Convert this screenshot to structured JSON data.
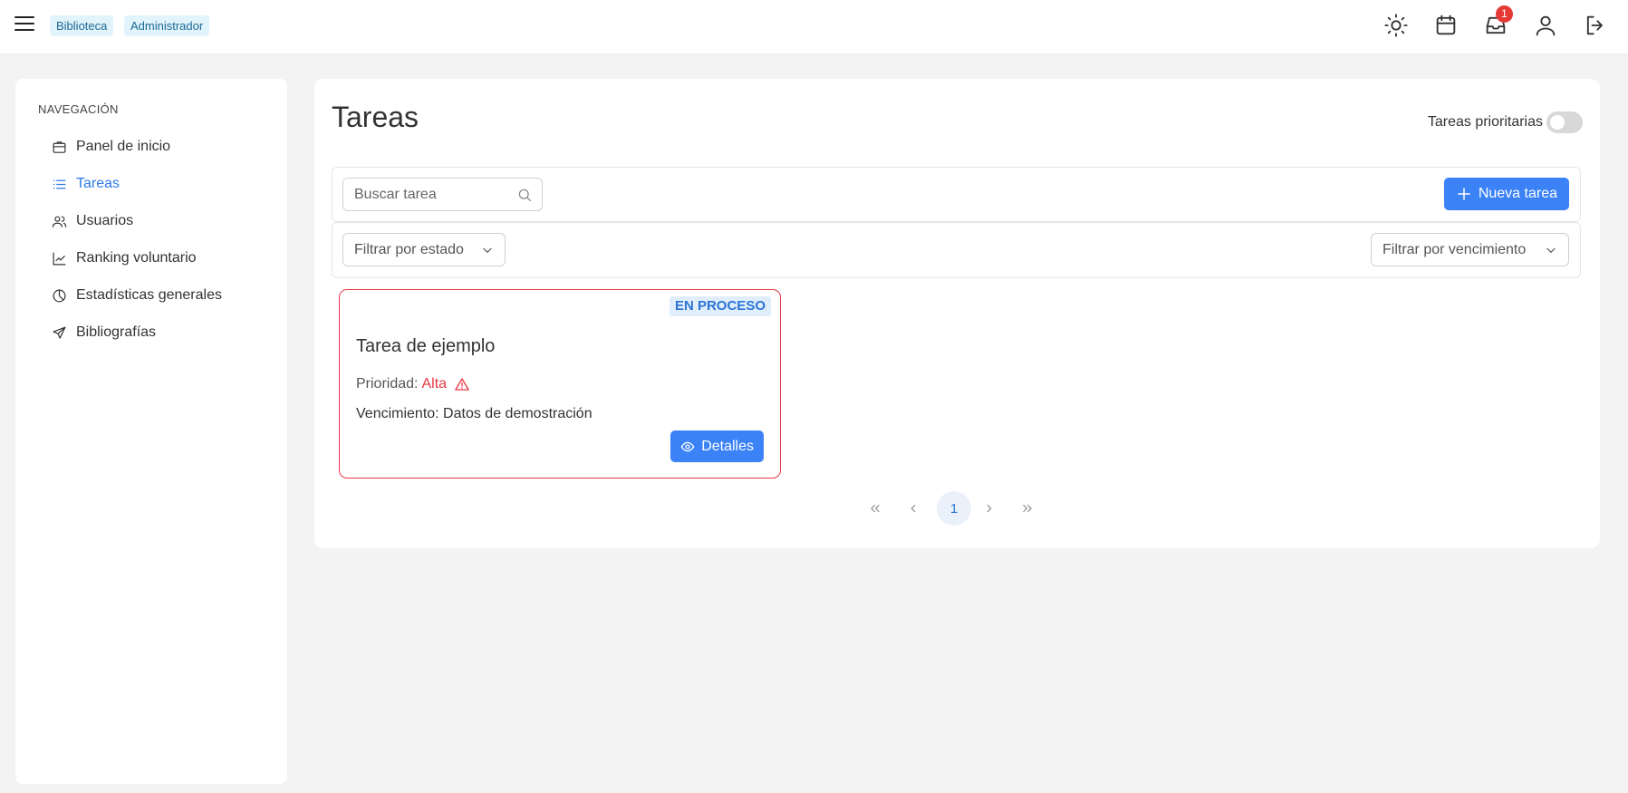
{
  "topbar": {
    "badges": [
      "Biblioteca",
      "Administrador"
    ],
    "notifications_count": "1",
    "icons": [
      "menu-icon",
      "sun-icon",
      "calendar-icon",
      "inbox-icon",
      "user-icon",
      "logout-icon"
    ]
  },
  "sidebar": {
    "heading": "NAVEGACIÓN",
    "items": [
      {
        "label": "Panel de inicio",
        "icon": "dashboard-icon"
      },
      {
        "label": "Tareas",
        "icon": "list-icon",
        "active": true
      },
      {
        "label": "Usuarios",
        "icon": "users-icon"
      },
      {
        "label": "Ranking voluntario",
        "icon": "chart-line-icon"
      },
      {
        "label": "Estadísticas generales",
        "icon": "pie-chart-icon"
      },
      {
        "label": "Bibliografías",
        "icon": "send-icon"
      }
    ]
  },
  "main": {
    "title": "Tareas",
    "priority_toggle_label": "Tareas prioritarias",
    "priority_toggle_on": false,
    "search_placeholder": "Buscar tarea",
    "new_button_label": "Nueva tarea",
    "filter_status_label": "Filtrar por estado",
    "filter_due_label": "Filtrar por vencimiento"
  },
  "task": {
    "status": "EN PROCESO",
    "title": "Tarea de ejemplo",
    "priority_label": "Prioridad:",
    "priority_value": "Alta",
    "due_text": "Vencimiento: Datos de demostración",
    "details_label": "Detalles"
  },
  "pagination": {
    "current_page": "1"
  },
  "colors": {
    "accent": "#3b82f6",
    "danger": "#e63946",
    "badge_bg": "#e1f3fb"
  }
}
